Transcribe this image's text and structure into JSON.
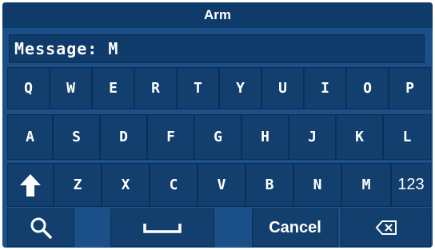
{
  "window": {
    "title": "Arm"
  },
  "message": {
    "value": "Message: M"
  },
  "keyboard": {
    "row1": [
      "Q",
      "W",
      "E",
      "R",
      "T",
      "Y",
      "U",
      "I",
      "O",
      "P"
    ],
    "row2": [
      "A",
      "S",
      "D",
      "F",
      "G",
      "H",
      "J",
      "K",
      "L"
    ],
    "row3": [
      "Z",
      "X",
      "C",
      "V",
      "B",
      "N",
      "M",
      "123"
    ],
    "shift_icon": "up-arrow-icon",
    "search_icon": "search-icon",
    "space_icon": "space-bar-icon",
    "backspace_icon": "backspace-icon",
    "cancel_label": "Cancel"
  },
  "colors": {
    "panel": "#1b4f87",
    "key": "#123f6e",
    "title_bar": "#0f3b6a",
    "text": "#ffffff"
  }
}
